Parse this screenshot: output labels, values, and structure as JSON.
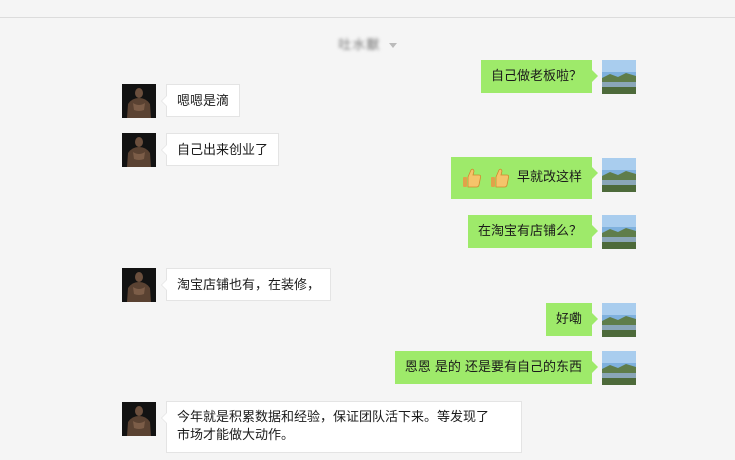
{
  "header": {
    "contact_name": "吐水獸"
  },
  "messages": [
    {
      "id": "m1",
      "side": "right",
      "text": "自己做老板啦？"
    },
    {
      "id": "m2",
      "side": "left",
      "text": "嗯嗯是滴"
    },
    {
      "id": "m3",
      "side": "left",
      "text": "自己出来创业了"
    },
    {
      "id": "m4",
      "side": "right",
      "emoji": [
        "thumbs-up",
        "thumbs-up"
      ],
      "text": "早就改这样"
    },
    {
      "id": "m5",
      "side": "right",
      "text": "在淘宝有店铺么？"
    },
    {
      "id": "m6",
      "side": "left",
      "text": "淘宝店铺也有，在装修，"
    },
    {
      "id": "m7",
      "side": "right",
      "text": "好嘞"
    },
    {
      "id": "m8",
      "side": "right",
      "text": "恩恩 是的 还是要有自己的东西"
    },
    {
      "id": "m9",
      "side": "left",
      "lines": [
        "今年就是积累数据和经验，保证团队活下来。等发现了",
        "市场才能做大动作。"
      ]
    }
  ],
  "colors": {
    "background": "#f5f5f5",
    "sent_bubble": "#9eea6a",
    "received_bubble": "#ffffff"
  }
}
